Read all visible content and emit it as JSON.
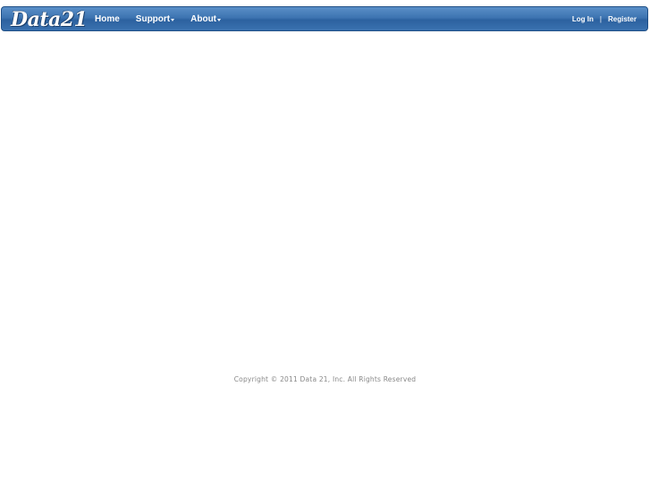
{
  "header": {
    "logo_text": "Data21",
    "nav": {
      "home": "Home",
      "support": "Support",
      "about": "About"
    },
    "auth": {
      "login": "Log In",
      "separator": "|",
      "register": "Register"
    }
  },
  "footer": {
    "copyright": "Copyright © 2011 Data 21, Inc. All Rights Reserved"
  },
  "colors": {
    "navbar_top": "#5a8fc8",
    "navbar_bottom": "#2c619f",
    "footer_text": "#888888"
  }
}
